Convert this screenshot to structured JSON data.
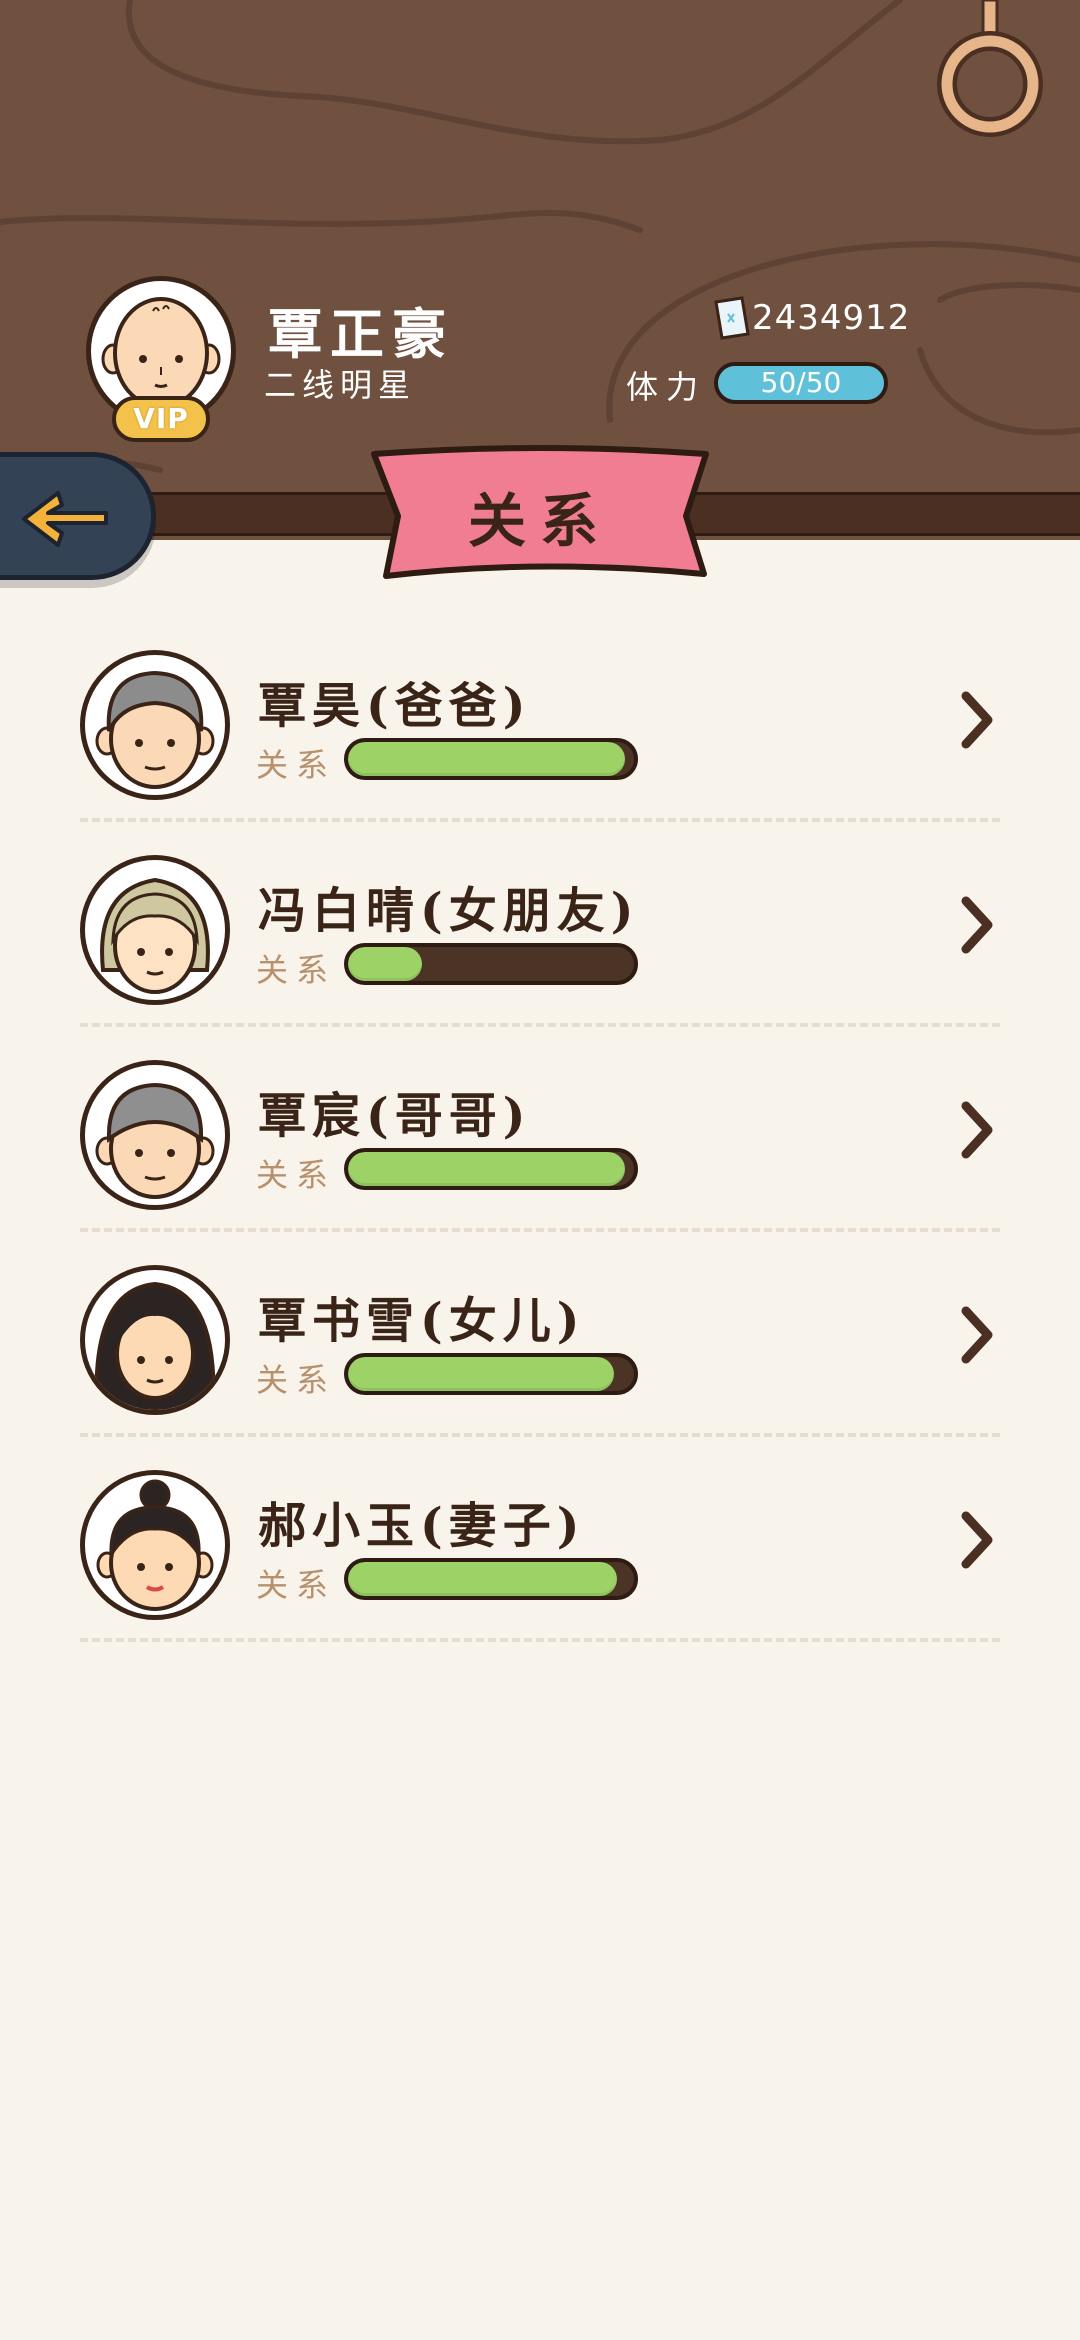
{
  "player": {
    "name": "覃正豪",
    "title": "二线明星",
    "vip_label": "VIP",
    "money": "2434912",
    "stamina_label": "体力",
    "stamina_value": "50/50"
  },
  "page_title": "关系",
  "relation_label": "关系",
  "icons": {
    "back": "arrow-left-icon",
    "money": "banknote-icon",
    "hanger": "ring-hanger-icon",
    "row": "chevron-right-icon"
  },
  "colors": {
    "wood": "#70503f",
    "banner": "#f07d92",
    "bar_fill": "#9cd266",
    "stamina": "#5fc0da",
    "vip": "#f2c24a"
  },
  "relations": [
    {
      "name": "覃昊(爸爸)",
      "level": 0.97
    },
    {
      "name": "冯白晴(女朋友)",
      "level": 0.26
    },
    {
      "name": "覃宸(哥哥)",
      "level": 0.97
    },
    {
      "name": "覃书雪(女儿)",
      "level": 0.93
    },
    {
      "name": "郝小玉(妻子)",
      "level": 0.94
    }
  ]
}
